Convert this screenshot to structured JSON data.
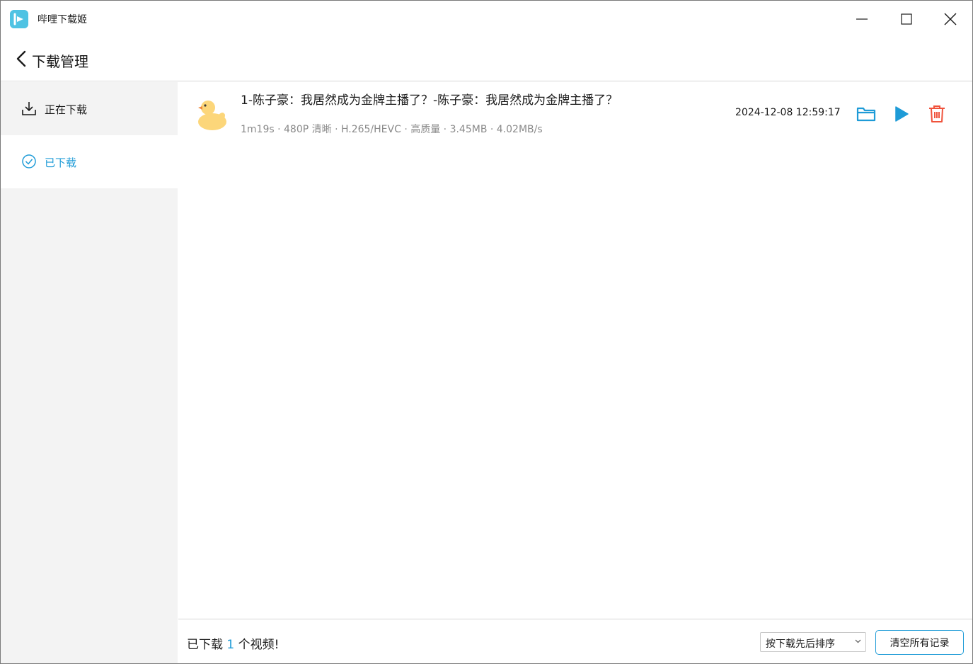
{
  "app": {
    "title": "哔哩下载姬",
    "accent": "#1e9bd7"
  },
  "header": {
    "title": "下载管理"
  },
  "sidebar": {
    "items": [
      {
        "label": "正在下载",
        "icon": "download-icon",
        "selected": false
      },
      {
        "label": "已下载",
        "icon": "check-circle-icon",
        "selected": true
      }
    ]
  },
  "downloads": [
    {
      "title": "1-陈子豪：我居然成为金牌主播了？-陈子豪：我居然成为金牌主播了？",
      "meta": "1m19s · 480P 清晰 · H.265/HEVC · 高质量 · 3.45MB · 4.02MB/s",
      "time": "2024-12-08 12:59:17",
      "cover_icon": "duck-icon"
    }
  ],
  "footer": {
    "count_prefix": "已下载",
    "count": "1",
    "count_suffix": "个视频!",
    "sort_selected": "按下载先后排序",
    "clear_label": "清空所有记录"
  }
}
